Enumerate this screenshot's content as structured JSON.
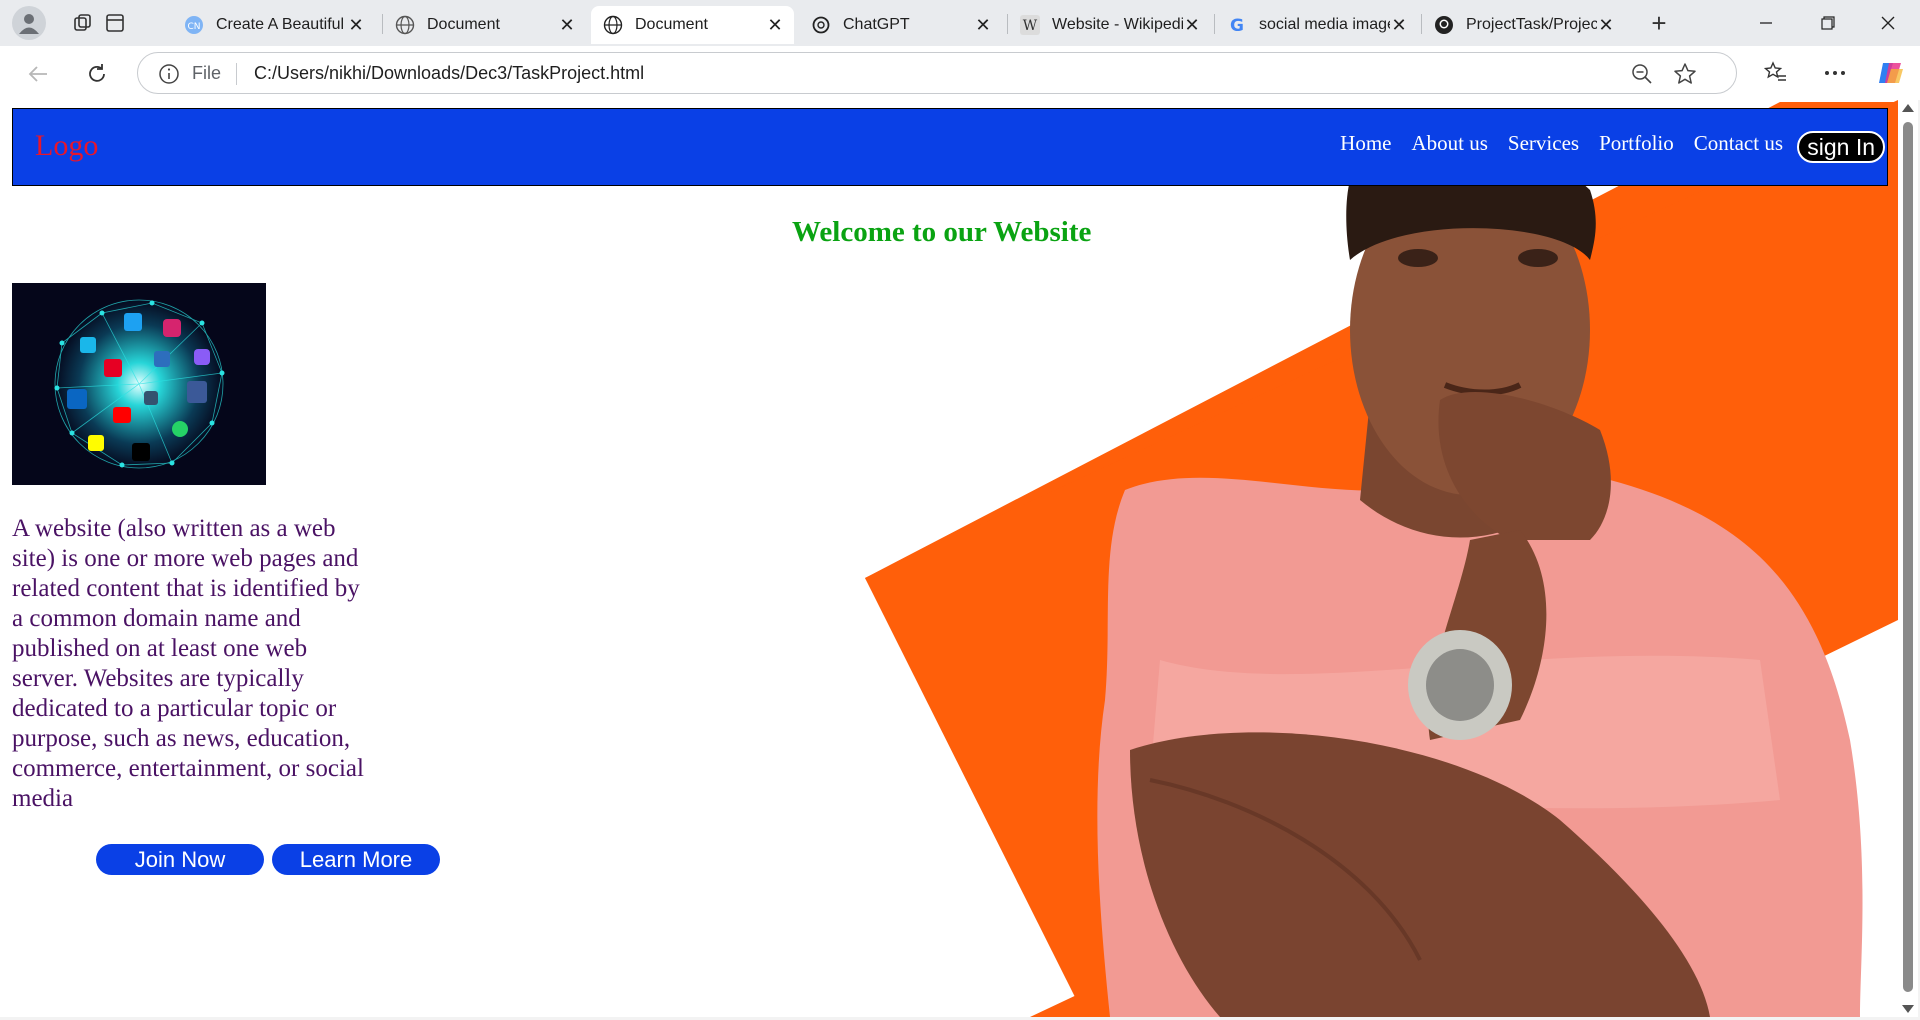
{
  "browser": {
    "tabs": [
      {
        "title": "Create A Beautiful",
        "icon": "ai-icon",
        "active": false
      },
      {
        "title": "Document",
        "icon": "globe-icon",
        "active": false
      },
      {
        "title": "Document",
        "icon": "globe-icon",
        "active": true
      },
      {
        "title": "ChatGPT",
        "icon": "chatgpt-icon",
        "active": false
      },
      {
        "title": "Website - Wikipedia",
        "icon": "wikipedia-icon",
        "active": false
      },
      {
        "title": "social media image",
        "icon": "google-icon",
        "active": false
      },
      {
        "title": "ProjectTask/Project",
        "icon": "github-icon",
        "active": false
      }
    ],
    "tab_close_glyph": "✕",
    "new_tab_glyph": "+",
    "address": {
      "scheme_label": "File",
      "url": "C:/Users/nikhi/Downloads/Dec3/TaskProject.html"
    }
  },
  "site": {
    "colors": {
      "header_bg": "#0a40e6",
      "logo": "#e8162b",
      "welcome": "#0aa312",
      "body_text": "#4a1264",
      "accent_orange": "#ff5f0a"
    },
    "logo": "Logo",
    "nav": [
      "Home",
      "About us",
      "Services",
      "Portfolio",
      "Contact us"
    ],
    "signin_label": "sign In",
    "welcome_heading": "Welcome to our Website",
    "intro_text": "A website (also written as a web site) is one or more web pages and related content that is identified by a common domain name and published on at least one web server. Websites are typically dedicated to a particular topic or purpose, such as news, education, commerce, entertainment, or social media",
    "join_label": "Join Now",
    "learn_label": "Learn More"
  }
}
